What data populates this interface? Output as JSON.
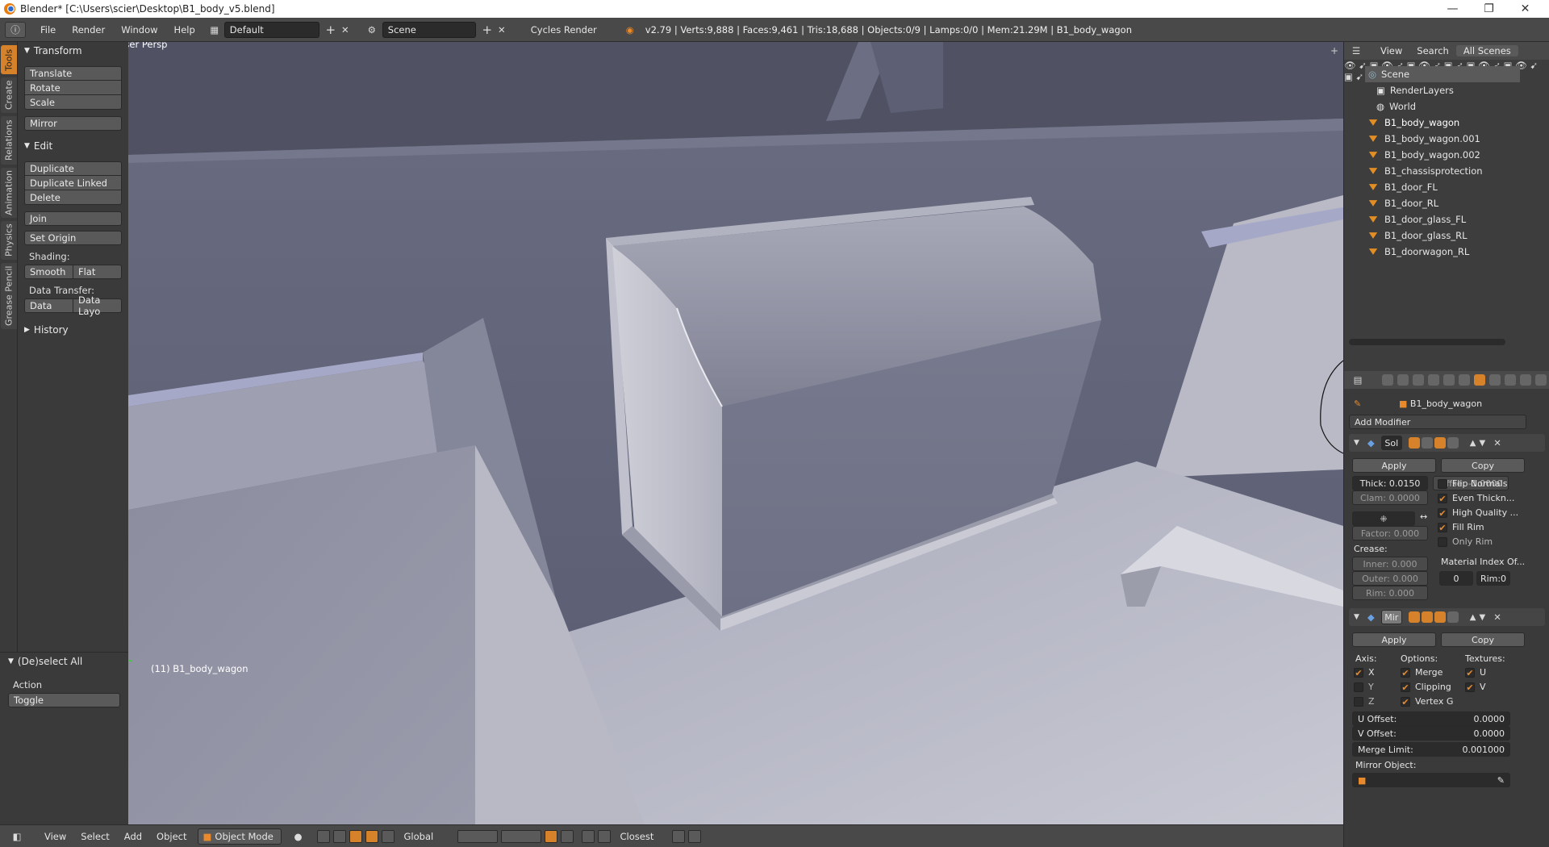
{
  "window": {
    "title": "Blender* [C:\\Users\\scier\\Desktop\\B1_body_v5.blend]",
    "minimize": "—",
    "maximize": "❐",
    "close": "✕"
  },
  "info_header": {
    "menus": [
      "File",
      "Render",
      "Window",
      "Help"
    ],
    "screen_layout": "Default",
    "scene": "Scene",
    "render_engine": "Cycles Render",
    "stats": "v2.79 | Verts:9,888 | Faces:9,461 | Tris:18,688 | Objects:0/9 | Lamps:0/0 | Mem:21.29M | B1_body_wagon"
  },
  "tool_tabs": [
    "Tools",
    "Create",
    "Relations",
    "Animation",
    "Physics",
    "Grease Pencil"
  ],
  "tool_shelf": {
    "transform_title": "Transform",
    "translate": "Translate",
    "rotate": "Rotate",
    "scale": "Scale",
    "mirror": "Mirror",
    "edit_title": "Edit",
    "duplicate": "Duplicate",
    "duplicate_linked": "Duplicate Linked",
    "delete": "Delete",
    "join": "Join",
    "set_origin": "Set Origin",
    "shading_label": "Shading:",
    "smooth": "Smooth",
    "flat": "Flat",
    "data_transfer_label": "Data Transfer:",
    "data": "Data",
    "data_layo": "Data Layo",
    "history_title": "History"
  },
  "operator_panel": {
    "title": "(De)select All",
    "action_label": "Action",
    "action_value": "Toggle"
  },
  "viewport": {
    "view_label": "User Persp",
    "object_label": "(11) B1_body_wagon"
  },
  "bottom_header": {
    "menus": [
      "View",
      "Select",
      "Add",
      "Object"
    ],
    "mode": "Object Mode",
    "orientation": "Global",
    "snap_target": "Closest"
  },
  "outliner": {
    "tabs": [
      "View",
      "Search",
      "All Scenes"
    ],
    "rows": [
      {
        "name": "Scene"
      },
      {
        "name": "RenderLayers"
      },
      {
        "name": "World"
      },
      {
        "name": "B1_body_wagon"
      },
      {
        "name": "B1_body_wagon.001"
      },
      {
        "name": "B1_body_wagon.002"
      },
      {
        "name": "B1_chassisprotection"
      },
      {
        "name": "B1_door_FL"
      },
      {
        "name": "B1_door_RL"
      },
      {
        "name": "B1_door_glass_FL"
      },
      {
        "name": "B1_door_glass_RL"
      },
      {
        "name": "B1_doorwagon_RL"
      }
    ]
  },
  "properties": {
    "object_name": "B1_body_wagon",
    "add_modifier": "Add Modifier",
    "solidify": {
      "name": "Sol",
      "apply": "Apply",
      "copy": "Copy",
      "thickness": "Thick: 0.0150",
      "offset": "Offse: -1.0000",
      "clamp": "Clam: 0.0000",
      "factor": "Factor: 0.000",
      "crease_label": "Crease:",
      "inner": "Inner:  0.000",
      "outer": "Outer:  0.000",
      "rim": "Rim:  0.000",
      "flip_normals": "Flip Normals",
      "even_thickness": "Even Thickn...",
      "high_quality": "High Quality ...",
      "fill_rim": "Fill Rim",
      "only_rim": "Only Rim",
      "material_index": "Material Index Of...",
      "mat_offset": "0",
      "rim_offset": "Rim:0"
    },
    "mirror": {
      "name": "Mir",
      "apply": "Apply",
      "copy": "Copy",
      "axis_label": "Axis:",
      "options_label": "Options:",
      "textures_label": "Textures:",
      "x": "X",
      "y": "Y",
      "z": "Z",
      "merge": "Merge",
      "clipping": "Clipping",
      "vertex_g": "Vertex G",
      "u": "U",
      "v": "V",
      "u_offset_label": "U Offset:",
      "u_offset": "0.0000",
      "v_offset_label": "V Offset:",
      "v_offset": "0.0000",
      "merge_limit_label": "Merge Limit:",
      "merge_limit": "0.001000",
      "mirror_object_label": "Mirror Object:"
    }
  },
  "colors": {
    "accent": "#d5822b",
    "viewport_bg": "#5c5e73",
    "panel_bg": "#3a3a3a",
    "header_bg": "#494949"
  }
}
